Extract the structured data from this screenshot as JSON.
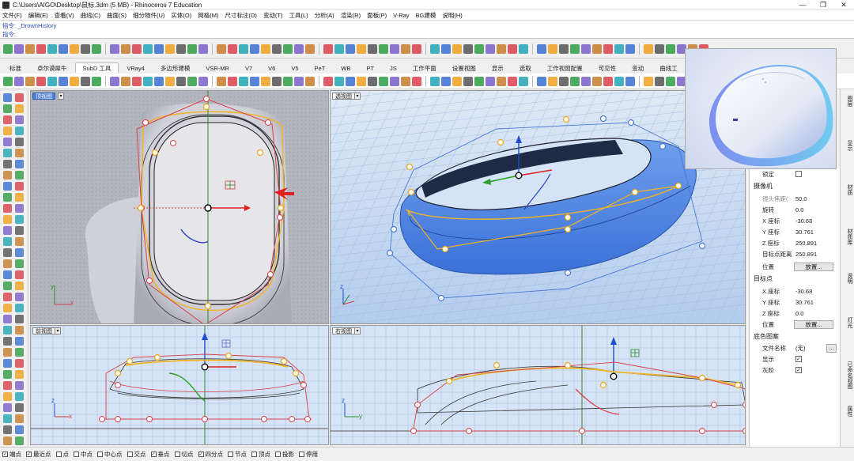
{
  "window": {
    "title": "C:\\Users\\AIGO\\Desktop\\鼠标.3dm (5 MB) - Rhinoceros 7 Education",
    "buttons": [
      "—",
      "❐",
      "✕"
    ]
  },
  "menu": [
    "文件(F)",
    "编辑(E)",
    "查看(V)",
    "曲线(C)",
    "曲面(S)",
    "细分物件(U)",
    "实体(O)",
    "网格(M)",
    "尺寸标注(D)",
    "变动(T)",
    "工具(L)",
    "分析(A)",
    "渲染(R)",
    "面板(P)",
    "V-Ray",
    "BG建模",
    "说明(H)"
  ],
  "command": {
    "history": "指令: _DrownHistory",
    "prompt": "指令:"
  },
  "tabs": [
    {
      "label": "标准",
      "active": false
    },
    {
      "label": "卓尔谟犀牛",
      "active": false
    },
    {
      "label": "SubD 工具",
      "active": true
    },
    {
      "label": "VRay4",
      "active": false
    },
    {
      "label": "多边形建模",
      "active": false
    },
    {
      "label": "VSR-MR",
      "active": false
    },
    {
      "label": "V7",
      "active": false
    },
    {
      "label": "V6",
      "active": false
    },
    {
      "label": "V5",
      "active": false
    },
    {
      "label": "PeT",
      "active": false
    },
    {
      "label": "WB",
      "active": false
    },
    {
      "label": "PT",
      "active": false
    },
    {
      "label": "JS",
      "active": false
    },
    {
      "label": "工作平面",
      "active": false
    },
    {
      "label": "设置视图",
      "active": false
    },
    {
      "label": "显示",
      "active": false
    },
    {
      "label": "选取",
      "active": false
    },
    {
      "label": "工作视窗配置",
      "active": false
    },
    {
      "label": "可见性",
      "active": false
    },
    {
      "label": "变动",
      "active": false
    },
    {
      "label": "曲线工",
      "active": false
    }
  ],
  "viewports": {
    "top": {
      "title": "顶视图",
      "active": true,
      "menu": "▾"
    },
    "perspective": {
      "title": "透视图",
      "active": false,
      "menu": "▾"
    },
    "front": {
      "title": "前视图",
      "active": false,
      "menu": "▾"
    },
    "right": {
      "title": "右视图",
      "active": false,
      "menu": "▾"
    }
  },
  "axis": {
    "x": "x",
    "y": "y",
    "z": "z"
  },
  "properties": {
    "lock_label": "锁定",
    "camera_section": "摄像机",
    "camera_rows": [
      {
        "key": "镜头焦距(",
        "value": "50.0",
        "grayed": true
      },
      {
        "key": "旋转",
        "value": "0.0"
      },
      {
        "key": "X 座标",
        "value": "-30.68"
      },
      {
        "key": "Y 座标",
        "value": "30.761"
      },
      {
        "key": "Z 座标",
        "value": "250.891"
      },
      {
        "key": "目标点距离",
        "value": "250.891"
      }
    ],
    "position_label": "位置",
    "place_button": "放置...",
    "target_section": "目标点",
    "target_rows": [
      {
        "key": "X 座标",
        "value": "-30.68"
      },
      {
        "key": "Y 座标",
        "value": "30.761"
      },
      {
        "key": "Z 座标",
        "value": "0.0"
      }
    ],
    "target_position_label": "位置",
    "target_place_button": "放置...",
    "bg_section": "底色图案",
    "filename_label": "文件名称",
    "filename_value": "(无)",
    "browse_button": "...",
    "show_label": "显示",
    "grayscale_label": "灰阶"
  },
  "side_tabs": [
    "图层",
    "显示",
    "材质",
    "材质库",
    "说明",
    "灯光",
    "已命名视图",
    "属性"
  ],
  "status_snaps": [
    {
      "label": "端点",
      "checked": true
    },
    {
      "label": "最近点",
      "checked": true
    },
    {
      "label": "点",
      "checked": false
    },
    {
      "label": "中点",
      "checked": false
    },
    {
      "label": "中心点",
      "checked": false
    },
    {
      "label": "交点",
      "checked": false
    },
    {
      "label": "垂点",
      "checked": true
    },
    {
      "label": "切点",
      "checked": false
    },
    {
      "label": "四分点",
      "checked": true
    },
    {
      "label": "节点",
      "checked": false
    },
    {
      "label": "顶点",
      "checked": false
    },
    {
      "label": "投影",
      "checked": false
    },
    {
      "label": "停用",
      "checked": false
    }
  ]
}
